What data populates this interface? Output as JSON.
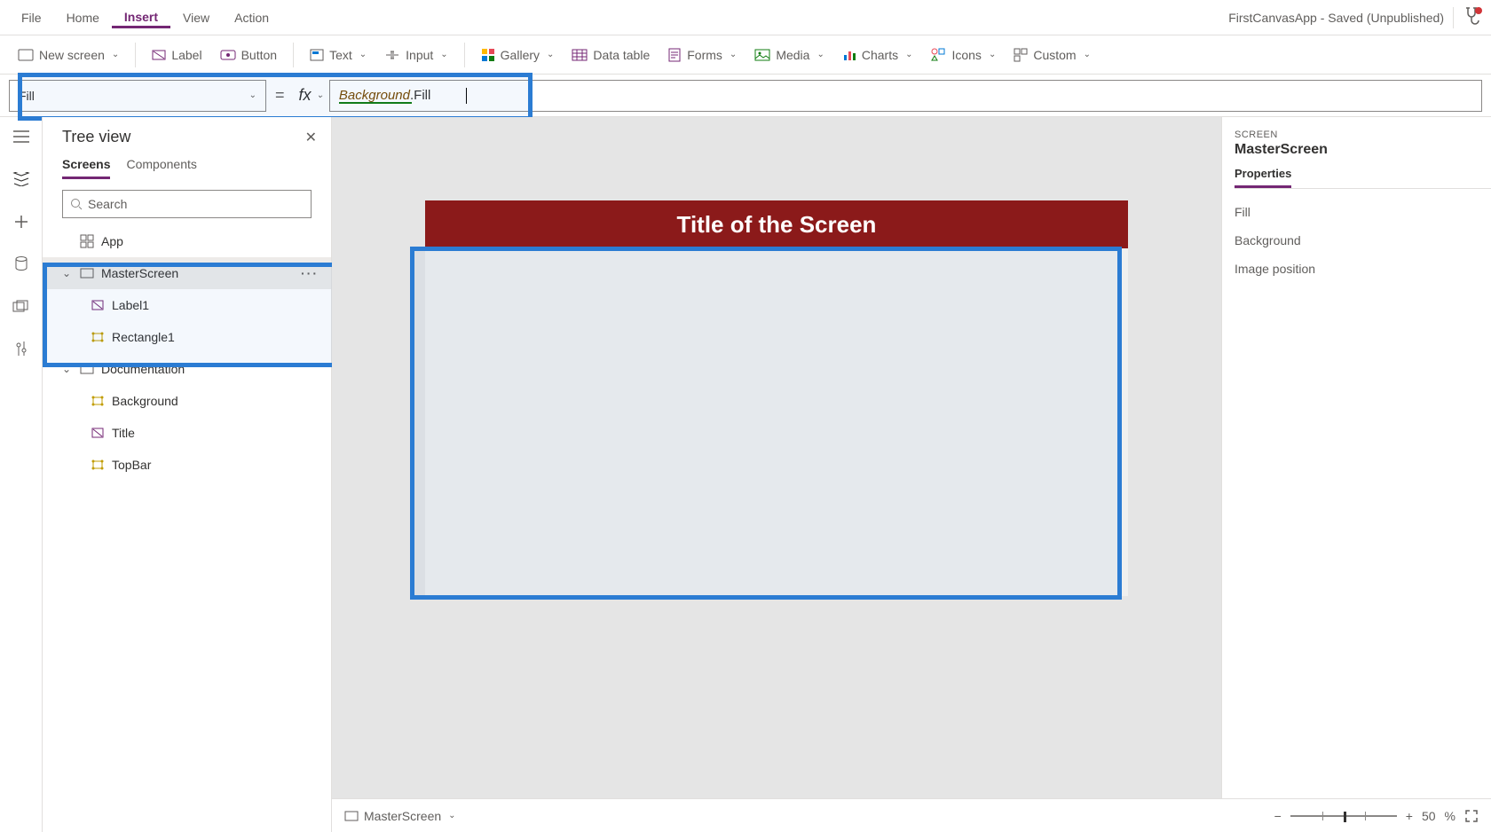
{
  "menu": {
    "items": [
      "File",
      "Home",
      "Insert",
      "View",
      "Action"
    ],
    "activeIndex": 2,
    "appStatus": "FirstCanvasApp - Saved (Unpublished)"
  },
  "ribbon": {
    "newScreen": "New screen",
    "label": "Label",
    "button": "Button",
    "text": "Text",
    "input": "Input",
    "gallery": "Gallery",
    "dataTable": "Data table",
    "forms": "Forms",
    "media": "Media",
    "charts": "Charts",
    "icons": "Icons",
    "custom": "Custom"
  },
  "formula": {
    "property": "Fill",
    "expressionPart1": "Background",
    "expressionDot": ".",
    "expressionPart2": "Fill"
  },
  "tree": {
    "title": "Tree view",
    "tabs": {
      "screens": "Screens",
      "components": "Components"
    },
    "searchPlaceholder": "Search",
    "app": "App",
    "masterScreen": "MasterScreen",
    "label1": "Label1",
    "rectangle1": "Rectangle1",
    "documentation": "Documentation",
    "background": "Background",
    "titleItem": "Title",
    "topBar": "TopBar",
    "more": "···"
  },
  "canvas": {
    "titleText": "Title of the Screen"
  },
  "props": {
    "sectionLabel": "SCREEN",
    "screenName": "MasterScreen",
    "tabProperties": "Properties",
    "rows": {
      "fill": "Fill",
      "background": "Background",
      "imagePos": "Image position"
    }
  },
  "status": {
    "screen": "MasterScreen",
    "zoomValue": "50",
    "zoomUnit": "%"
  }
}
